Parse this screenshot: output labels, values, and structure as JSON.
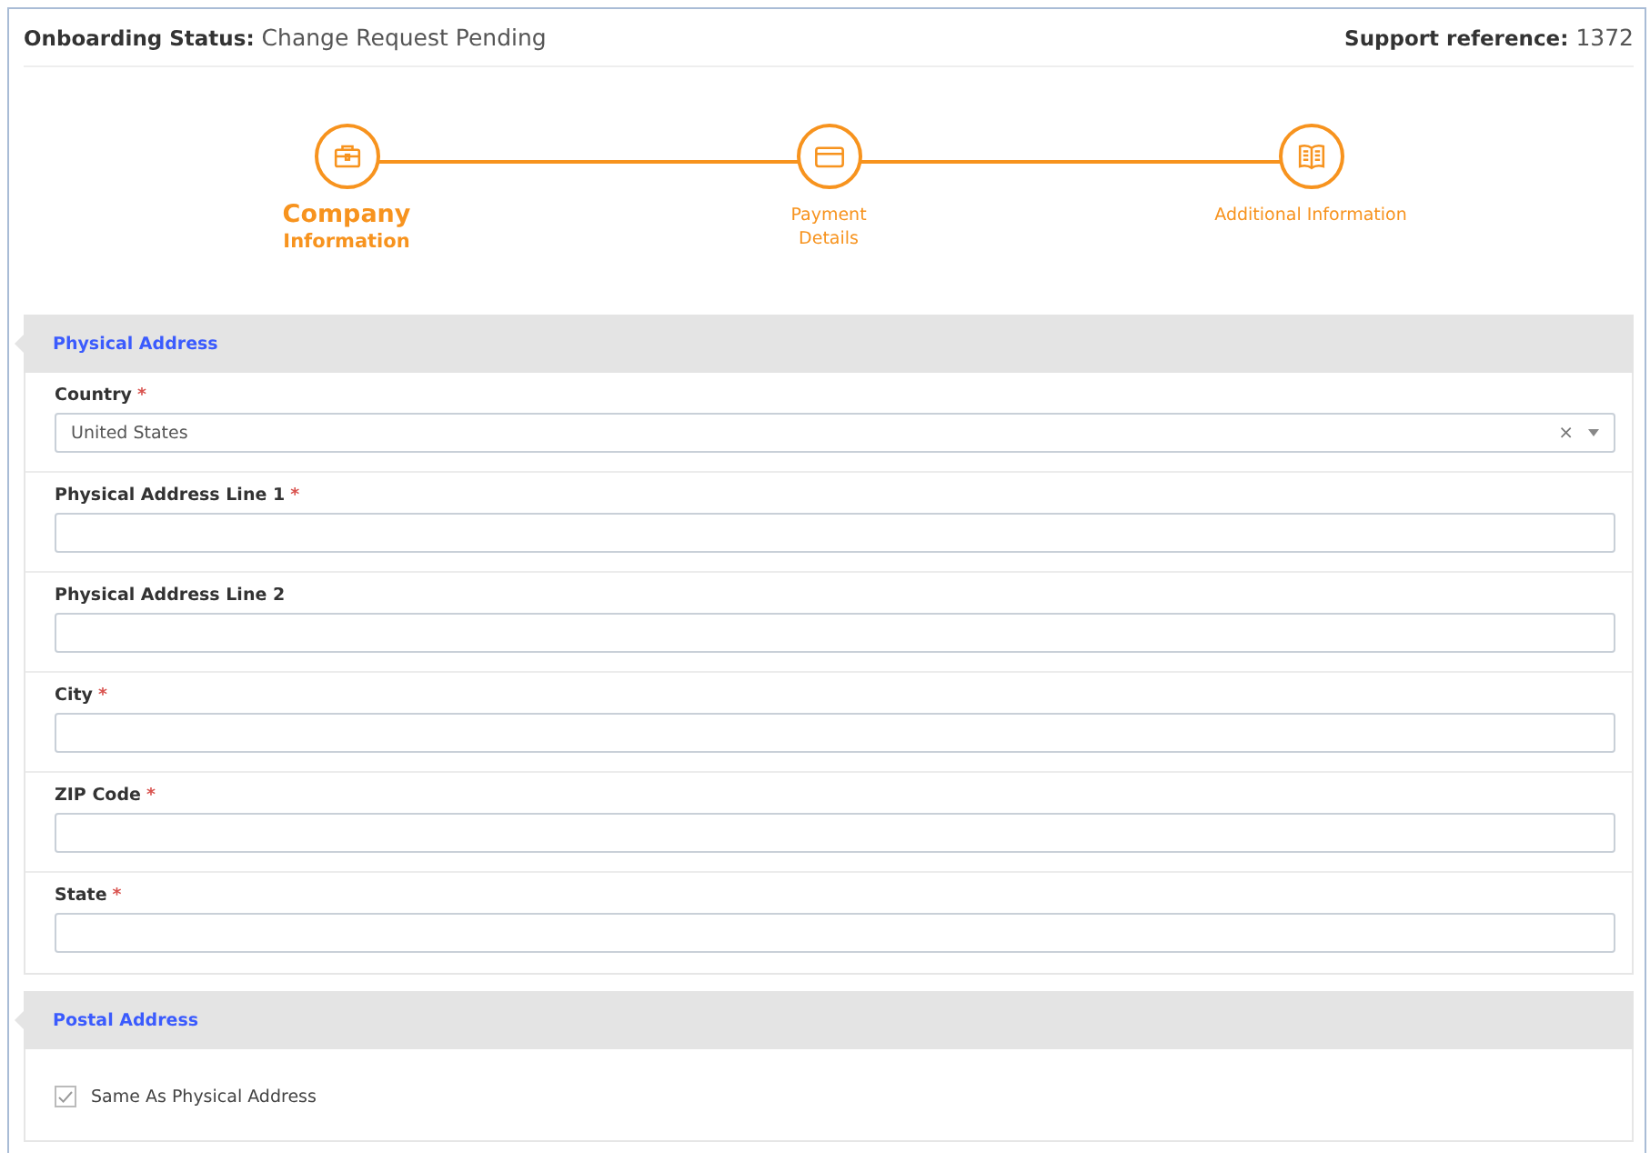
{
  "header": {
    "status_label": "Onboarding Status:",
    "status_value": "Change Request Pending",
    "reference_label": "Support reference:",
    "reference_value": "1372"
  },
  "steps": [
    {
      "kind": "briefcase",
      "lines": [
        "Company",
        "Information"
      ],
      "selected": true
    },
    {
      "kind": "card",
      "lines": [
        "Payment",
        "Details"
      ],
      "selected": false
    },
    {
      "kind": "book",
      "lines": [
        "Additional Information"
      ],
      "selected": false
    }
  ],
  "sections": [
    {
      "title": "Physical Address",
      "fields": [
        {
          "kind": "select",
          "label": "Country",
          "required_mark": "*",
          "value": "United States",
          "clear": "×"
        },
        {
          "kind": "text",
          "label": "Physical Address Line 1",
          "required_mark": "*"
        },
        {
          "kind": "text",
          "label": "Physical Address Line 2"
        },
        {
          "kind": "text",
          "label": "City",
          "required_mark": "*"
        },
        {
          "kind": "text",
          "label": "ZIP Code",
          "required_mark": "*"
        },
        {
          "kind": "text",
          "label": "State",
          "required_mark": "*"
        }
      ]
    },
    {
      "title": "Postal Address",
      "fields": [
        {
          "kind": "checkbox",
          "label": "Same As Physical Address",
          "checked": true
        }
      ]
    }
  ]
}
